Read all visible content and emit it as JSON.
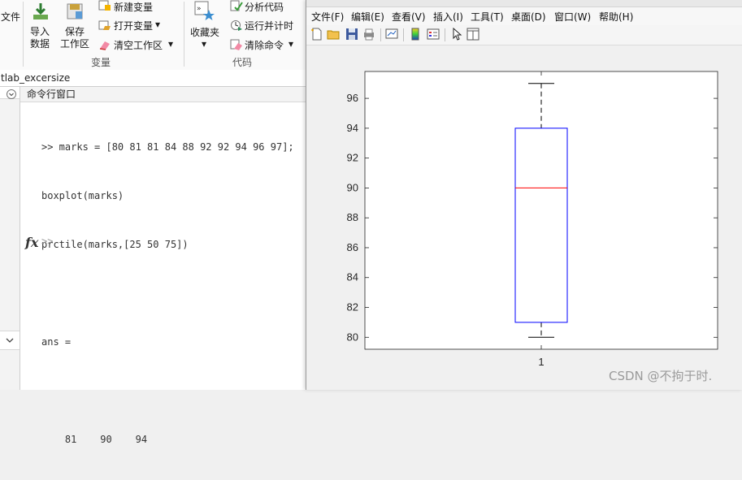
{
  "toolstrip": {
    "file_partial": "文件",
    "import_label_1": "导入",
    "import_label_2": "数据",
    "save_label_1": "保存",
    "save_label_2": "工作区",
    "new_variable": "新建变量",
    "open_variable": "打开变量",
    "clear_workspace": "清空工作区",
    "favorites": "收藏夹",
    "analyze_code": "分析代码",
    "run_and_time": "运行并计时",
    "clear_commands": "清除命令",
    "section_variable": "变量",
    "section_code": "代码"
  },
  "pathbar": {
    "folder": "tlab_excersize"
  },
  "command_window": {
    "title": "命令行窗口",
    "lines": [
      ">> marks = [80 81 81 84 88 92 92 94 96 97];",
      "boxplot(marks)",
      "prctile(marks,[25 50 75])",
      "",
      "ans =",
      "",
      "    81    90    94"
    ],
    "fx_symbol": "fx",
    "prompt": ">>"
  },
  "figure": {
    "menus": [
      "文件(F)",
      "编辑(E)",
      "查看(V)",
      "插入(I)",
      "工具(T)",
      "桌面(D)",
      "窗口(W)",
      "帮助(H)"
    ],
    "toolbar_icons": [
      "new-figure-icon",
      "open-file-icon",
      "save-icon",
      "print-icon",
      "link-plot-icon",
      "colorbar-icon",
      "legend-icon",
      "pointer-icon",
      "property-editor-icon"
    ]
  },
  "chart_data": {
    "type": "box",
    "categories": [
      "1"
    ],
    "box": {
      "min": 80,
      "q1": 81,
      "median": 90,
      "q3": 94,
      "max": 97
    },
    "ylim": [
      79.2,
      97.8
    ],
    "yticks": [
      80,
      82,
      84,
      86,
      88,
      90,
      92,
      94,
      96
    ],
    "box_color": "#0000ff",
    "median_color": "#ff0000",
    "whisker_color": "#000000",
    "grid": false
  },
  "watermark": "CSDN @不拘于时."
}
